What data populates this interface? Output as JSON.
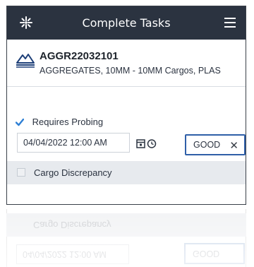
{
  "header": {
    "title": "Complete Tasks",
    "left_icon": "sparkle-icon",
    "menu_icon": "hamburger-menu-icon",
    "background": "#2b3340"
  },
  "item": {
    "code": "AGGR22032101",
    "description": "AGGREGATES, 10MM - 10MM Cargos, PLAS",
    "icon": "mountain-icon"
  },
  "probing": {
    "label": "Requires Probing",
    "checked": true,
    "datetime_value": "04/04/2022 12:00 AM",
    "datetime_icons": [
      "calendar-icon",
      "clock-icon"
    ],
    "result_value": "GOOD",
    "clear_icon": "close-icon"
  },
  "cargo_discrepancy": {
    "label": "Cargo Discrepancy",
    "checked": false
  },
  "colors": {
    "accent": "#2f5fa8",
    "check": "#2e7fd4",
    "row_bg": "#e7eaee"
  }
}
